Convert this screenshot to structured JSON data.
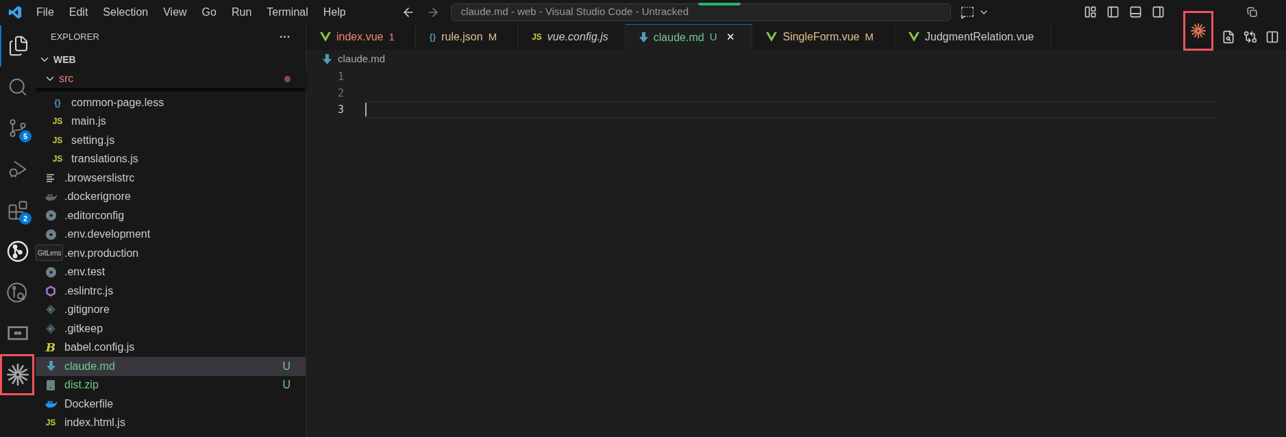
{
  "title_bar": {
    "menus": [
      "File",
      "Edit",
      "Selection",
      "View",
      "Go",
      "Run",
      "Terminal",
      "Help"
    ],
    "command_center": "claude.md - web - Visual Studio Code - Untracked"
  },
  "activity_bar": [
    {
      "kind": "files",
      "selected": true
    },
    {
      "kind": "search",
      "selected": false
    },
    {
      "kind": "source-control",
      "selected": false,
      "badge": "5"
    },
    {
      "kind": "debug",
      "selected": false
    },
    {
      "kind": "extensions",
      "selected": false,
      "badge": "2"
    },
    {
      "kind": "gitlens",
      "selected": false,
      "tooltip": "GitLens"
    },
    {
      "kind": "gitlens-inspect",
      "selected": false
    },
    {
      "kind": "remote",
      "selected": false
    },
    {
      "kind": "spark",
      "selected": false,
      "highlighted": true
    }
  ],
  "explorer": {
    "title": "EXPLORER",
    "more": "···",
    "root": {
      "name": "WEB",
      "expanded": true,
      "children": [
        {
          "name": "src",
          "expanded": true,
          "color": "#e8806f",
          "dot": true,
          "selected": false,
          "children": [
            {
              "name": "common-page.less",
              "kind": "braces",
              "icon_text": "{}",
              "color": "#cccccc",
              "selected": false
            },
            {
              "name": "main.js",
              "kind": "js",
              "icon_text": "JS",
              "color": "#cccccc",
              "selected": false
            },
            {
              "name": "setting.js",
              "kind": "js",
              "icon_text": "JS",
              "color": "#cccccc",
              "selected": false
            },
            {
              "name": "translations.js",
              "kind": "js",
              "icon_text": "JS",
              "color": "#cccccc",
              "selected": false
            }
          ]
        },
        {
          "name": ".browserslistrc",
          "kind": "lines",
          "color": "#cccccc",
          "selected": false
        },
        {
          "name": ".dockerignore",
          "kind": "docker-grey",
          "color": "#cccccc",
          "selected": false
        },
        {
          "name": ".editorconfig",
          "kind": "gear",
          "color": "#cccccc",
          "selected": false
        },
        {
          "name": ".env.development",
          "kind": "gear",
          "color": "#cccccc",
          "selected": false
        },
        {
          "name": ".env.production",
          "color": "#cccccc",
          "selected": false
        },
        {
          "name": ".env.test",
          "kind": "gear",
          "color": "#cccccc",
          "selected": false
        },
        {
          "name": ".eslintrc.js",
          "kind": "eslint",
          "color": "#cccccc",
          "selected": false
        },
        {
          "name": ".gitignore",
          "kind": "git",
          "color": "#cccccc",
          "selected": false
        },
        {
          "name": ".gitkeep",
          "kind": "git",
          "color": "#cccccc",
          "selected": false
        },
        {
          "name": "babel.config.js",
          "kind": "babel",
          "icon_text": "B",
          "color": "#cccccc",
          "selected": false
        },
        {
          "name": "claude.md",
          "kind": "markdown",
          "color": "#73c991",
          "status": "U",
          "selected": true
        },
        {
          "name": "dist.zip",
          "kind": "zip",
          "color": "#73c991",
          "status": "U",
          "selected": false
        },
        {
          "name": "Dockerfile",
          "kind": "docker",
          "color": "#cccccc",
          "selected": false
        },
        {
          "name": "index.html.js",
          "kind": "js",
          "icon_text": "JS",
          "color": "#cccccc",
          "selected": false
        }
      ]
    }
  },
  "tabs": [
    {
      "label": "index.vue",
      "kind": "vue",
      "badge": "1",
      "color": "#f48771",
      "italic": false,
      "selected": false
    },
    {
      "label": "rule.json",
      "kind": "braces",
      "icon_text": "{}",
      "badge": "M",
      "color": "#e2c08d",
      "italic": false,
      "selected": false
    },
    {
      "label": "vue.config.js",
      "kind": "js",
      "icon_text": "JS",
      "color": "#cccccc",
      "italic": true,
      "selected": false
    },
    {
      "label": "claude.md",
      "kind": "markdown",
      "badge": "U",
      "color": "#73c991",
      "italic": false,
      "selected": true,
      "close": "✕"
    },
    {
      "label": "SingleForm.vue",
      "kind": "vue",
      "badge": "M",
      "color": "#e2c08d",
      "italic": false,
      "selected": false
    },
    {
      "label": "JudgmentRelation.vue",
      "kind": "vue",
      "color": "#cccccc",
      "italic": false,
      "selected": false
    }
  ],
  "editor": {
    "breadcrumb": "claude.md",
    "lines": [
      {
        "number": "1",
        "current": false
      },
      {
        "number": "2",
        "current": false
      },
      {
        "number": "3",
        "current": true
      }
    ]
  }
}
